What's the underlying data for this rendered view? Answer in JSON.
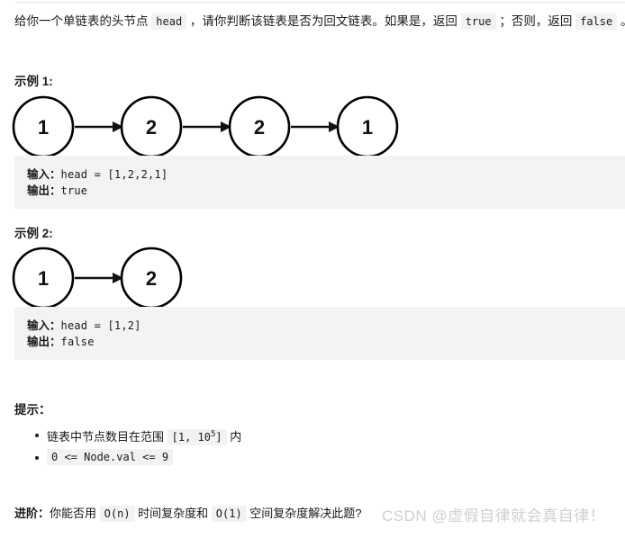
{
  "problem": {
    "description_parts": [
      {
        "type": "text",
        "text": "给你一个单链表的头节点 "
      },
      {
        "type": "code",
        "text": "head"
      },
      {
        "type": "text",
        "text": " ，请你判断该链表是否为回文链表。如果是，返回 "
      },
      {
        "type": "code",
        "text": "true"
      },
      {
        "type": "text",
        "text": " ；否则，返回 "
      },
      {
        "type": "code",
        "text": "false"
      },
      {
        "type": "text",
        "text": " 。"
      }
    ]
  },
  "examples": [
    {
      "title": "示例 1:",
      "nodes": [
        "1",
        "2",
        "2",
        "1"
      ],
      "input_label": "输入：",
      "input_value": "head = [1,2,2,1]",
      "output_label": "输出：",
      "output_value": "true"
    },
    {
      "title": "示例 2:",
      "nodes": [
        "1",
        "2"
      ],
      "input_label": "输入：",
      "input_value": "head = [1,2]",
      "output_label": "输出：",
      "output_value": "false"
    }
  ],
  "hints": {
    "title": "提示：",
    "items": [
      {
        "parts": [
          {
            "type": "text",
            "text": "链表中节点数目在范围 "
          },
          {
            "type": "code",
            "text": "[1, 10^5]"
          },
          {
            "type": "text",
            "text": " 内"
          }
        ]
      },
      {
        "parts": [
          {
            "type": "code",
            "text": "0 <= Node.val <= 9"
          }
        ]
      }
    ]
  },
  "footer": {
    "label": "进阶：",
    "parts": [
      {
        "type": "text",
        "text": "你能否用 "
      },
      {
        "type": "code",
        "text": "O(n)"
      },
      {
        "type": "text",
        "text": " 时间复杂度和 "
      },
      {
        "type": "code",
        "text": "O(1)"
      },
      {
        "type": "text",
        "text": " 空间复杂度解决此题?"
      }
    ]
  },
  "watermark": "CSDN @虚假自律就会真自律！",
  "colors": {
    "code_block_bg": "#f2f3f5",
    "inline_code_bg": "#f2f2f4",
    "text": "#1a1a1a",
    "watermark": "#d0d0d2",
    "node_stroke": "#000000"
  }
}
